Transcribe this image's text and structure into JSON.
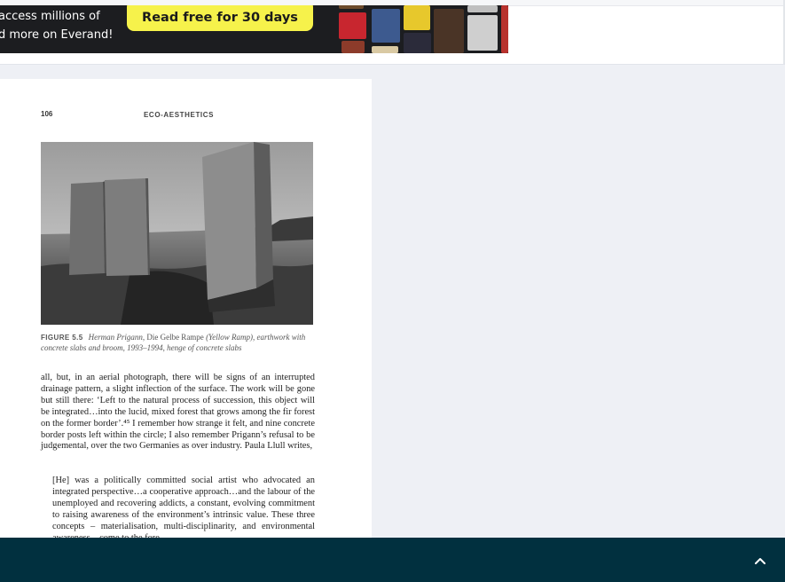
{
  "banner": {
    "line1": "access millions of",
    "line2": "d more on Everand!",
    "cta_label": "Read free for 30 days",
    "accent_color": "#f6f24b"
  },
  "page": {
    "page_number": "106",
    "running_head": "ECO-AESTHETICS",
    "figure": {
      "label": "FIGURE 5.5",
      "artist": "Herman Prigann",
      "work": "Die Gelbe Rampe",
      "rest": "(Yellow Ramp), earthwork with concrete slabs and broom, 1993–1994, henge of concrete slabs"
    },
    "body_text": "all, but, in an aerial photograph, there will be signs of an interrupted drainage pattern, a slight inflection of the surface. The work will be gone but still there: ‘Left to the natural process of succession, this object will be integrated…into the lucid, mixed forest that grows among the fir forest on the former border’.⁴⁵ I remember how strange it felt, and nine concrete border posts left within the circle; I also remember Prigann’s refusal to be judgemental, over the two Germanies as over industry. Paula Llull writes,",
    "quote_text": "[He] was a politically committed social artist who advocated an integrated perspective…a cooperative approach…and the labour of the unemployed and recovering addicts, a constant, evolving commitment to raising awareness of the environment’s intrinsic value. These three concepts – materialisation, multi-disciplinarity, and environmental awareness – come to the fore"
  },
  "bottom_bar": {
    "color": "#01303f",
    "up_icon": "chevron-up-icon"
  }
}
